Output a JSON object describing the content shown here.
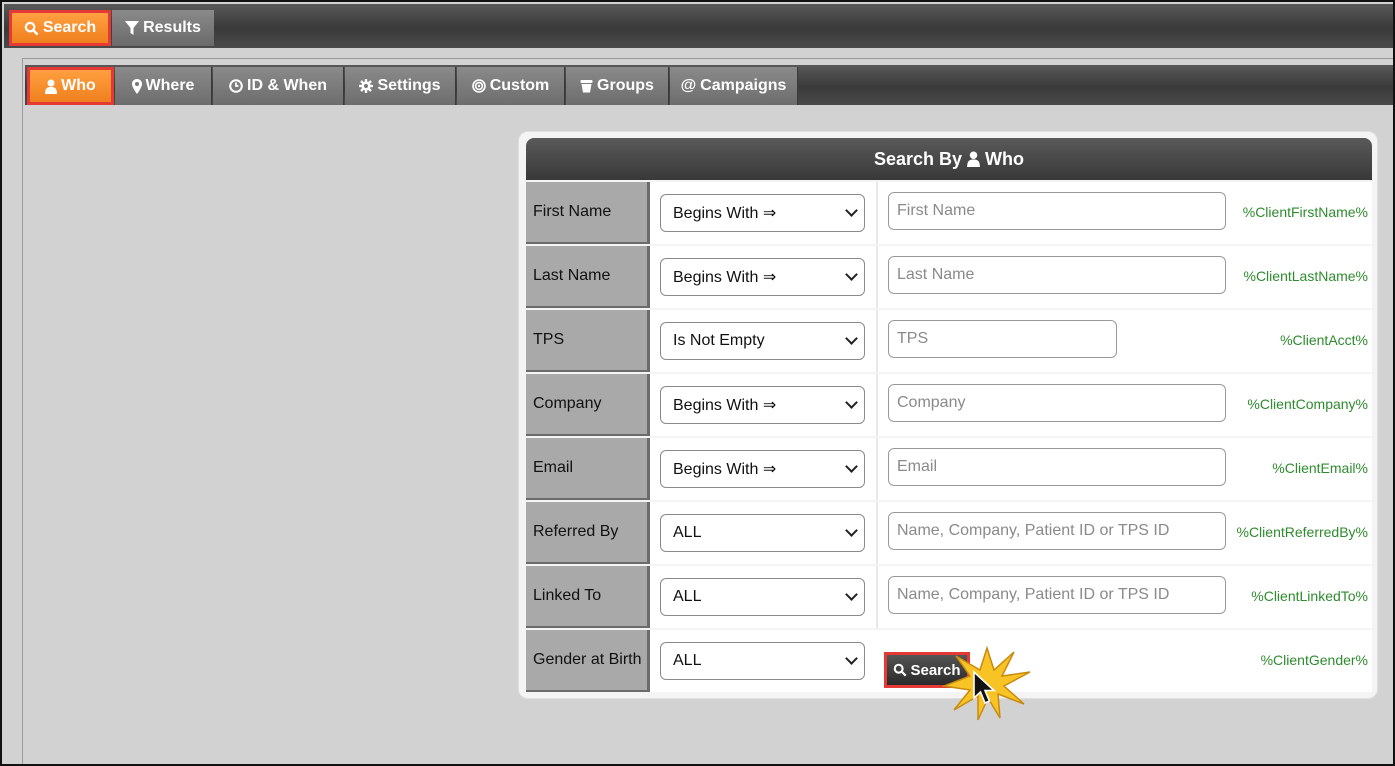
{
  "top_tabs": [
    {
      "label": "Search",
      "icon": "search-icon"
    },
    {
      "label": "Results",
      "icon": "filter-icon"
    }
  ],
  "sub_tabs": [
    {
      "label": "Who",
      "icon": "person-icon"
    },
    {
      "label": "Where",
      "icon": "map-marker-icon"
    },
    {
      "label": "ID & When",
      "icon": "clock-icon"
    },
    {
      "label": "Settings",
      "icon": "gear-icon"
    },
    {
      "label": "Custom",
      "icon": "bullseye-icon"
    },
    {
      "label": "Groups",
      "icon": "group-icon"
    },
    {
      "label": "Campaigns",
      "icon": "at-icon"
    }
  ],
  "card": {
    "title_prefix": "Search By",
    "title_suffix": "Who"
  },
  "rows": [
    {
      "label": "First Name",
      "operator": "Begins With ⇒",
      "placeholder": "First Name",
      "token": "%ClientFirstName%"
    },
    {
      "label": "Last Name",
      "operator": "Begins With ⇒",
      "placeholder": "Last Name",
      "token": "%ClientLastName%"
    },
    {
      "label": "TPS",
      "operator": "Is Not Empty",
      "placeholder": "TPS",
      "token": "%ClientAcct%"
    },
    {
      "label": "Company",
      "operator": "Begins With ⇒",
      "placeholder": "Company",
      "token": "%ClientCompany%"
    },
    {
      "label": "Email",
      "operator": "Begins With ⇒",
      "placeholder": "Email",
      "token": "%ClientEmail%"
    },
    {
      "label": "Referred By",
      "operator": "ALL",
      "placeholder": "Name, Company, Patient ID or TPS ID",
      "token": "%ClientReferredBy%"
    },
    {
      "label": "Linked To",
      "operator": "ALL",
      "placeholder": "Name, Company, Patient ID or TPS ID",
      "token": "%ClientLinkedTo%"
    },
    {
      "label": "Gender at Birth",
      "operator": "ALL",
      "placeholder": "",
      "token": "%ClientGender%"
    }
  ],
  "search_button": {
    "label": "Search",
    "icon": "search-icon"
  },
  "colors": {
    "accent": "#f5891f",
    "highlight": "#e53935",
    "token": "#2e8b2e"
  }
}
